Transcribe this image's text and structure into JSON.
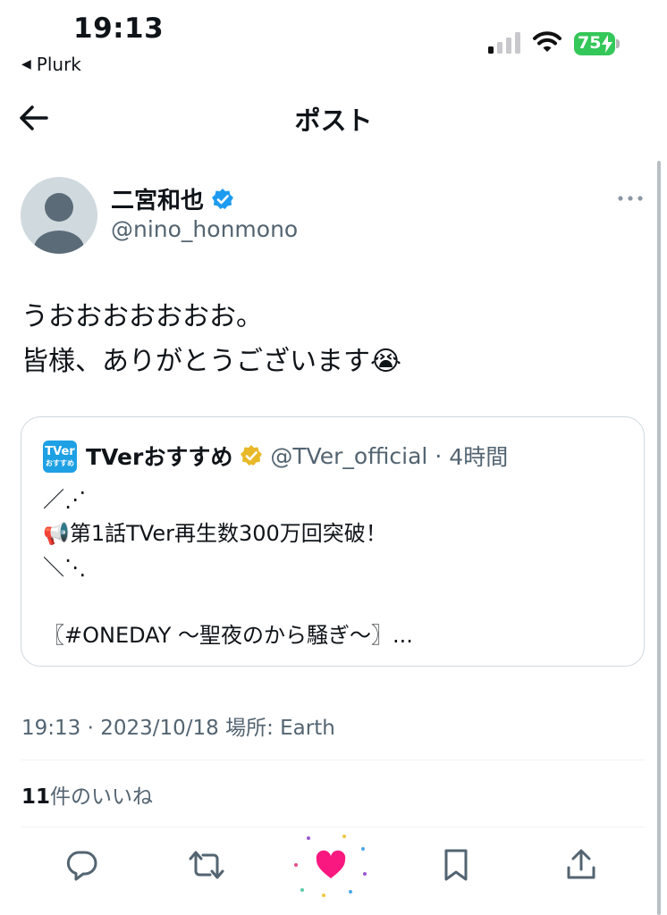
{
  "status_bar": {
    "time": "19:13",
    "back_app": "Plurk",
    "battery_level": "75",
    "battery_color": "#34c759"
  },
  "nav": {
    "title": "ポスト",
    "back_icon": "arrow-left-icon"
  },
  "post": {
    "author_name": "二宮和也",
    "author_handle": "@nino_honmono",
    "verified_color": "#1d9bf0",
    "text": "うおおおおおおお。\n皆様、ありがとうございます😭",
    "quote": {
      "logo_text": "TVer",
      "logo_sub": "おすすめ",
      "name": "TVerおすすめ",
      "badge_color": "#e8b828",
      "handle": "@TVer_official",
      "time": "4時間",
      "body": "／⋰\n📢第1話TVer再生数300万回突破！\n＼⋱\n\n〖#ONEDAY 〜聖夜のから騒ぎ〜〗..."
    },
    "timestamp": "19:13 · 2023/10/18 場所: Earth",
    "likes_count": "11",
    "likes_label": "件のいいね",
    "like_color": "#f91880"
  },
  "actions": [
    "reply-icon",
    "retweet-icon",
    "like-icon",
    "bookmark-icon",
    "share-icon"
  ]
}
